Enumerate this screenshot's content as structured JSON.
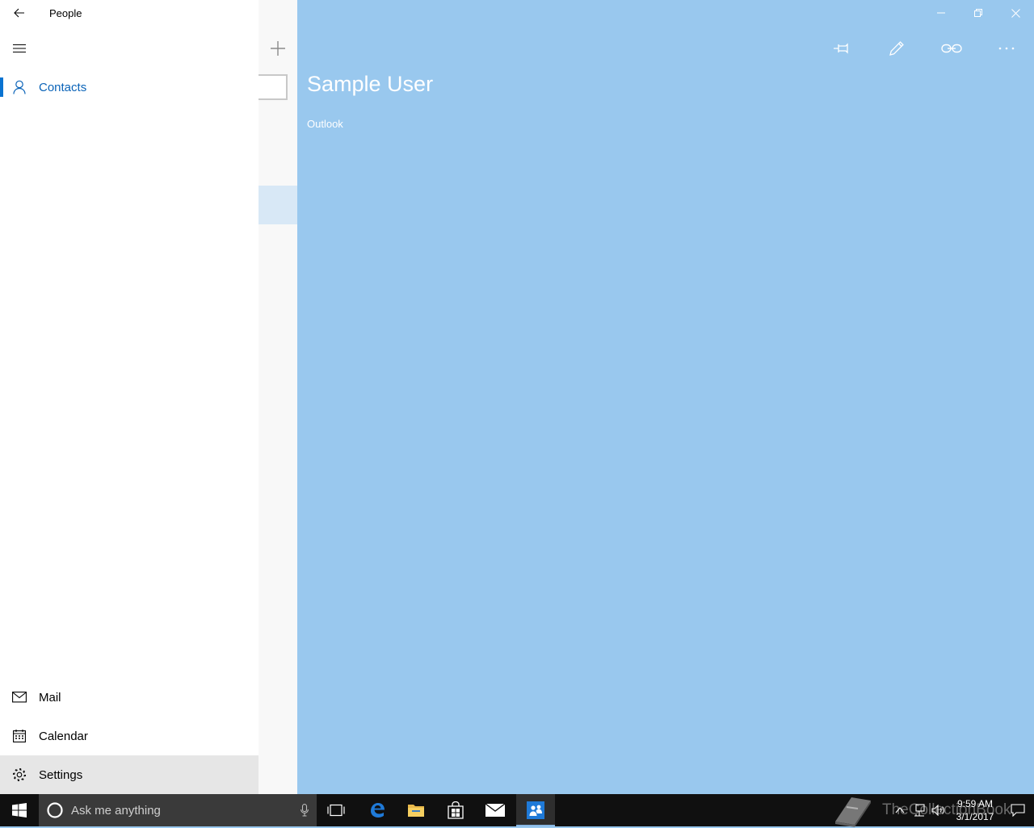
{
  "app": {
    "title": "People"
  },
  "nav": {
    "items": [
      {
        "label": "Contacts",
        "icon": "person-icon",
        "active": true
      }
    ],
    "bottom_items": [
      {
        "label": "Mail",
        "icon": "mail-icon"
      },
      {
        "label": "Calendar",
        "icon": "calendar-icon"
      },
      {
        "label": "Settings",
        "icon": "gear-icon"
      }
    ]
  },
  "detail": {
    "contact_name": "Sample User",
    "source": "Outlook",
    "commands": [
      "pin-icon",
      "edit-icon",
      "link-icon",
      "more-icon"
    ]
  },
  "taskbar": {
    "search_placeholder": "Ask me anything",
    "time": "9:59 AM",
    "date": "3/1/2017",
    "watermark": "TheCollectionBook"
  },
  "colors": {
    "accent": "#0a73d1",
    "detail_bg": "#99c8ee",
    "taskbar_bg": "#101010"
  }
}
